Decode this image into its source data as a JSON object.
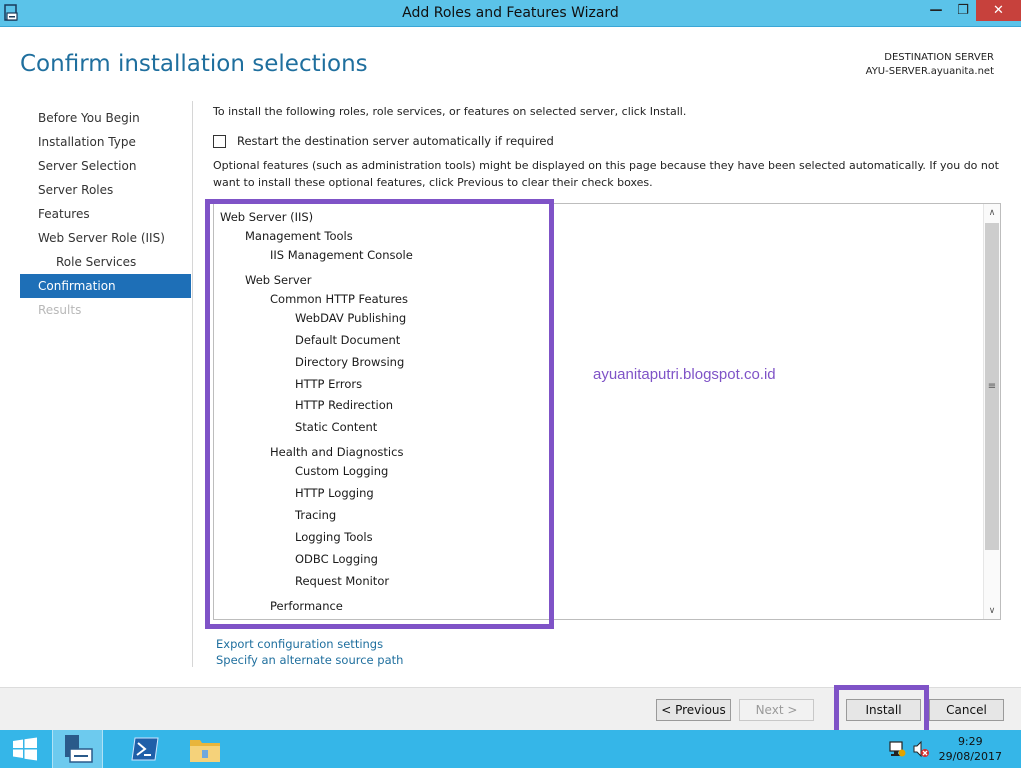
{
  "window": {
    "title": "Add Roles and Features Wizard",
    "minimize_glyph": "—",
    "maximize_glyph": "❐",
    "close_glyph": "✕",
    "accent": "#5bc3e9"
  },
  "header": {
    "page_title": "Confirm installation selections",
    "dest_label": "DESTINATION SERVER",
    "dest_server": "AYU-SERVER.ayuanita.net"
  },
  "nav": {
    "items": [
      {
        "label": "Before You Begin"
      },
      {
        "label": "Installation Type"
      },
      {
        "label": "Server Selection"
      },
      {
        "label": "Server Roles"
      },
      {
        "label": "Features"
      },
      {
        "label": "Web Server Role (IIS)"
      },
      {
        "label": "Role Services"
      },
      {
        "label": "Confirmation"
      },
      {
        "label": "Results"
      }
    ],
    "active_color": "#1e6fb7"
  },
  "content": {
    "intro": "To install the following roles, role services, or features on selected server, click Install.",
    "restart_label": "Restart the destination server automatically if required",
    "restart_checked": false,
    "optional_note": "Optional features (such as administration tools) might be displayed on this page because they have been selected automatically. If you do not want to install these optional features, click Previous to clear their check boxes.",
    "tree": [
      "Web Server (IIS)",
      "Management Tools",
      "IIS Management Console",
      "Web Server",
      "Common HTTP Features",
      "WebDAV Publishing",
      "Default Document",
      "Directory Browsing",
      "HTTP Errors",
      "HTTP Redirection",
      "Static Content",
      "Health and Diagnostics",
      "Custom Logging",
      "HTTP Logging",
      "Tracing",
      "Logging Tools",
      "ODBC Logging",
      "Request Monitor",
      "Performance"
    ],
    "scroll_up_glyph": "∧",
    "scroll_down_glyph": "∨",
    "scroll_grip_glyph": "≡",
    "watermark": "ayuanitaputri.blogspot.co.id",
    "export_link": "Export configuration settings",
    "alt_source_link": "Specify an alternate source path",
    "highlight_color": "#7f53c7"
  },
  "footer": {
    "previous": "< Previous",
    "next": "Next >",
    "install": "Install",
    "cancel": "Cancel"
  },
  "taskbar": {
    "time": "9:29",
    "date": "29/08/2017",
    "icons": [
      "start-icon",
      "server-manager-icon",
      "powershell-icon",
      "file-explorer-icon",
      "network-icon",
      "volume-muted-icon"
    ]
  }
}
